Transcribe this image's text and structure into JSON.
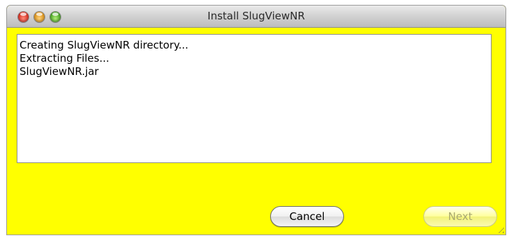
{
  "window": {
    "title": "Install SlugViewNR",
    "background_color": "#ffff00"
  },
  "log": {
    "lines": [
      "Creating SlugViewNR directory...",
      "Extracting Files...",
      "SlugViewNR.jar"
    ]
  },
  "buttons": {
    "cancel_label": "Cancel",
    "next_label": "Next",
    "next_enabled": false
  }
}
